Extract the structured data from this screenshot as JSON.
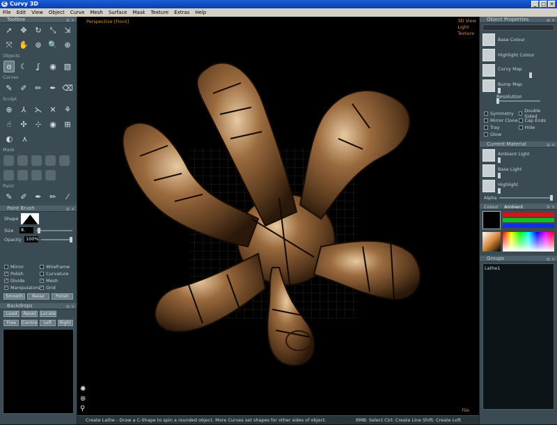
{
  "window": {
    "title": "Curvy 3D",
    "min": "_",
    "max": "□",
    "close": "✕"
  },
  "menu": [
    "File",
    "Edit",
    "View",
    "Object",
    "Curve",
    "Mesh",
    "Surface",
    "Mask",
    "Texture",
    "Extras",
    "Help"
  ],
  "toolbox": {
    "title": "Toolbox",
    "objects_label": "Objects",
    "curves_label": "Curves",
    "sculpt_label": "Sculpt",
    "mask_label": "Mask",
    "paint_label": "Paint"
  },
  "paint_brush": {
    "title": "Paint Brush",
    "shape_label": "Shape",
    "size_label": "Size",
    "size_value": "8.",
    "opacity_label": "Opacity",
    "opacity_value": "100%",
    "checks": [
      {
        "label": "Mirror",
        "checked": false
      },
      {
        "label": "Wireframe",
        "checked": false
      },
      {
        "label": "Polish",
        "checked": true
      },
      {
        "label": "Curvature",
        "checked": false
      },
      {
        "label": "Divide",
        "checked": true
      },
      {
        "label": "Mesh",
        "checked": true
      },
      {
        "label": "Manipulators",
        "checked": true
      },
      {
        "label": "Grid",
        "checked": true
      }
    ],
    "buttons": [
      "Smooth",
      "Relax",
      "Polish"
    ]
  },
  "backdrops": {
    "title": "Backdrops",
    "row1": [
      "Load",
      "Reset",
      "Locate"
    ],
    "row2": [
      "Free",
      "Centre",
      "Left",
      "Right"
    ]
  },
  "viewport": {
    "label": "Perspective [Front]",
    "options": [
      "3D View",
      "Light",
      "Texture"
    ],
    "file": "File"
  },
  "status": {
    "message": "Create Lathe - Draw a C-Shape to spin a rounded object. More Curves set shapes for other sides of object.",
    "hints": "RMB: Select    Ctrl: Create Line    Shift: Create Loft"
  },
  "object_properties": {
    "title": "Object Properties",
    "base_colour": "Base Colour",
    "highlight_colour": "Highlight Colour",
    "curvy_map": "Curvy Map",
    "bump_map": "Bump Map",
    "resolution": "Resolution",
    "checks": [
      {
        "label": "Symmetry",
        "checked": false
      },
      {
        "label": "Double Sided",
        "checked": false
      },
      {
        "label": "Mirror Clone",
        "checked": false
      },
      {
        "label": "Cap Ends",
        "checked": false
      },
      {
        "label": "Tray",
        "checked": false
      },
      {
        "label": "Hide",
        "checked": false
      },
      {
        "label": "Glow",
        "checked": false
      }
    ]
  },
  "current_material": {
    "title": "Current Material",
    "ambient_light": "Ambient Light",
    "base_light": "Base Light",
    "highlight": "Highlight",
    "alpha": "Alpha"
  },
  "colour": {
    "tab1": "Colour",
    "tab2": "Ambient",
    "red": "#e01010",
    "green": "#10c020",
    "blue": "#1030e0"
  },
  "groups": {
    "title": "Groups",
    "items": [
      "Lathe1"
    ]
  }
}
